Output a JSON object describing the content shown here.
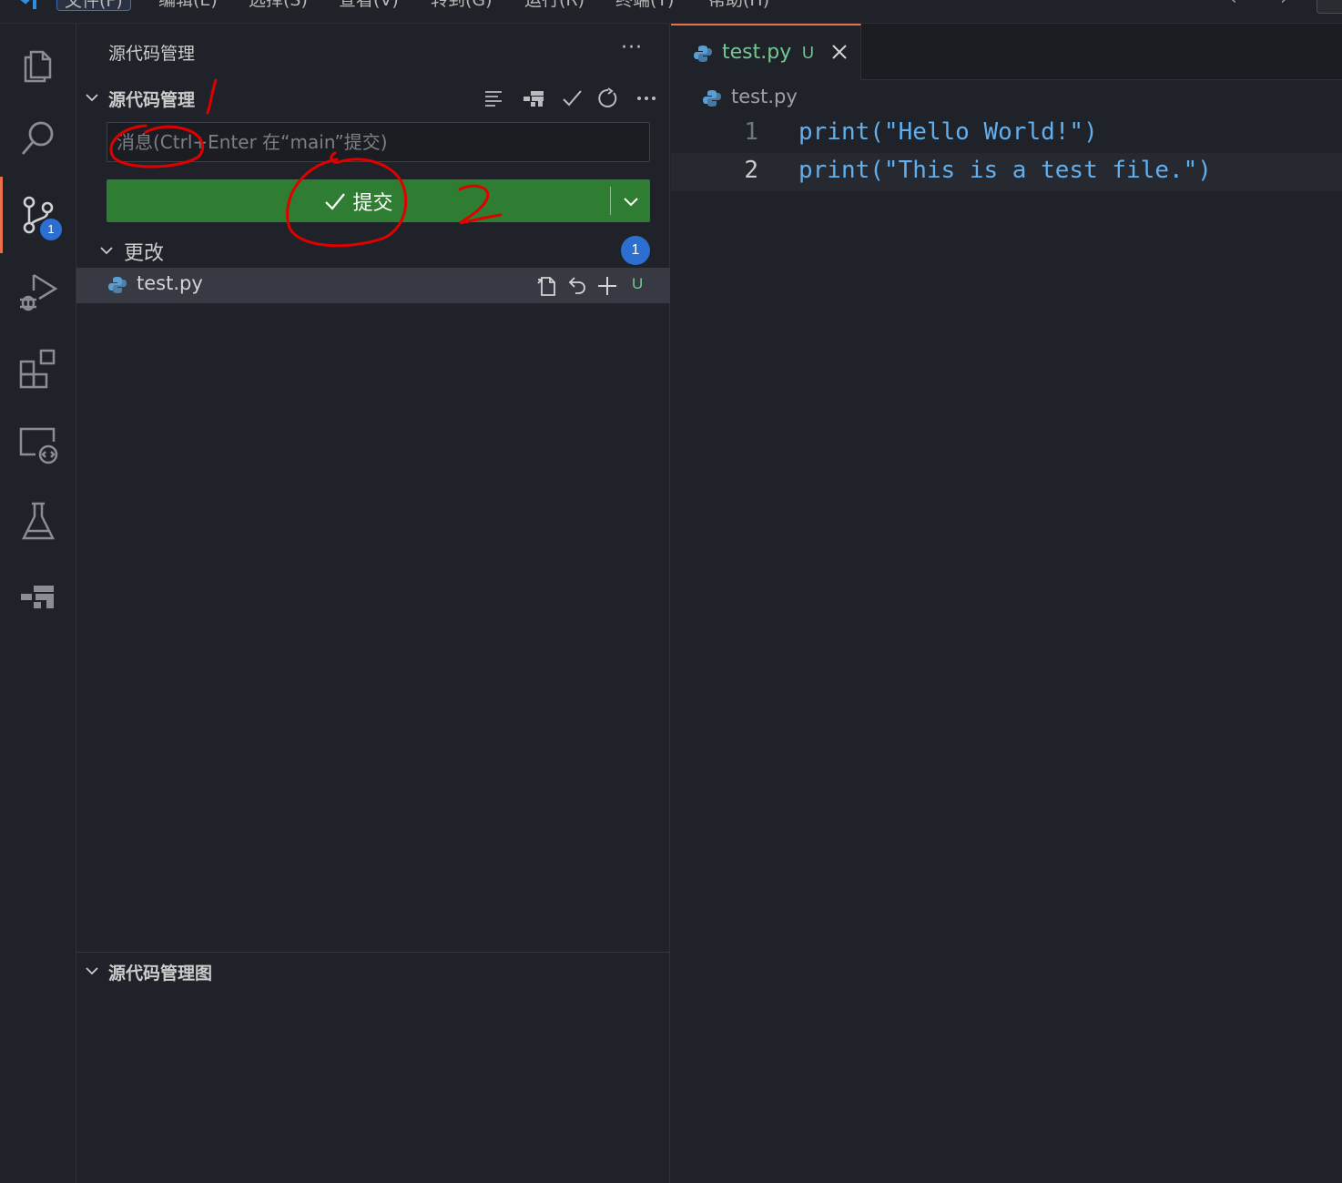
{
  "menubar": {
    "items": [
      "文件(F)",
      "编辑(E)",
      "选择(S)",
      "查看(V)",
      "转到(G)",
      "运行(R)",
      "终端(T)",
      "帮助(H)"
    ]
  },
  "activity_bar": {
    "items": [
      {
        "name": "explorer",
        "icon": "files-icon"
      },
      {
        "name": "search",
        "icon": "search-icon"
      },
      {
        "name": "source-control",
        "icon": "source-control-icon",
        "badge": "1",
        "active": true
      },
      {
        "name": "run-debug",
        "icon": "run-debug-icon"
      },
      {
        "name": "extensions",
        "icon": "extensions-icon"
      },
      {
        "name": "remote-explorer",
        "icon": "remote-explorer-icon"
      },
      {
        "name": "testing",
        "icon": "flask-icon"
      },
      {
        "name": "git-graph",
        "icon": "git-graph-icon"
      }
    ]
  },
  "sidebar": {
    "title": "源代码管理",
    "more": "···",
    "scm_section": {
      "title": "源代码管理",
      "actions": [
        "view-as-tree-icon",
        "git-graph-icon",
        "check-icon",
        "refresh-icon",
        "more-icon"
      ]
    },
    "commit": {
      "placeholder": "消息(Ctrl+Enter 在“main”提交)",
      "button_label": "提交"
    },
    "changes": {
      "label": "更改",
      "count": "1",
      "files": [
        {
          "name": "test.py",
          "status": "U"
        }
      ]
    },
    "graph_section": {
      "title": "源代码管理图"
    }
  },
  "editor": {
    "tab": {
      "name": "test.py",
      "status": "U"
    },
    "breadcrumb": "test.py",
    "lines": [
      {
        "number": "1",
        "text": "print(\"Hello World!\")"
      },
      {
        "number": "2",
        "text": "print(\"This is a test file.\")"
      }
    ]
  },
  "colors": {
    "accent": "#e8714a",
    "commit_green": "#2f7d32",
    "badge_blue": "#2d6fd0",
    "untracked_green": "#73c991",
    "code_blue": "#61afef",
    "annotation_red": "#e00000"
  }
}
